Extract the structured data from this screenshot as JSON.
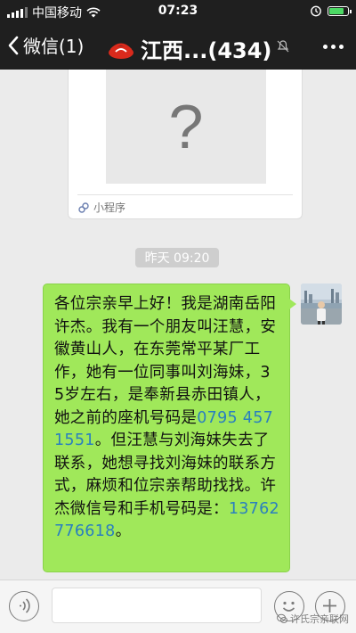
{
  "status_bar": {
    "carrier": "中国移动",
    "time": "07:23",
    "signal_icon": "signal-bars-icon",
    "wifi_icon": "wifi-icon",
    "alarm_icon": "alarm-icon",
    "battery_level": 0.9,
    "battery_color": "#4cd964"
  },
  "nav": {
    "back_label": "微信(1)",
    "title": "江西...(434)",
    "mute_icon": "mute-icon",
    "menu_icon": "more-dots-icon",
    "background": "#1f1f1f"
  },
  "mini_program": {
    "thumb_glyph": "?",
    "footer_label": "小程序"
  },
  "timestamp": "昨天 09:20",
  "message": {
    "text_before": "各位宗亲早上好！我是湖南岳阳许杰。我有一个朋友叫汪慧，安徽黄山人，在东莞常平某厂工作，她有一位同事叫刘海妹，35岁左右，是奉新县赤田镇人，她之前的座机号码是",
    "phone1": "0795 4571551",
    "text_middle": "。但汪慧与刘海妹失去了联系，她想寻找刘海妹的联系方式，麻烦和位宗亲帮助找找。许杰微信号和手机号码是：",
    "phone2": "13762776618",
    "text_after": "。",
    "bubble_color": "#a0e85a",
    "link_color": "#2a7fbf"
  },
  "input_bar": {
    "voice_icon": "voice-icon",
    "emoji_icon": "emoji-icon",
    "plus_icon": "plus-icon"
  },
  "watermark": "许氏宗亲联网"
}
